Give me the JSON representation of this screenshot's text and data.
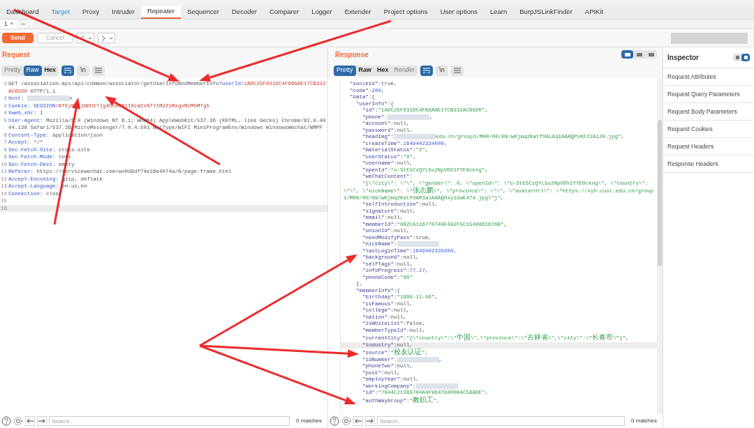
{
  "tabs": [
    {
      "label": "Dashboard",
      "selected": false,
      "highlighted": false
    },
    {
      "label": "Target",
      "selected": false,
      "highlighted": true
    },
    {
      "label": "Proxy",
      "selected": false,
      "highlighted": false
    },
    {
      "label": "Intruder",
      "selected": false,
      "highlighted": false
    },
    {
      "label": "Repeater",
      "selected": true,
      "highlighted": false
    },
    {
      "label": "Sequencer",
      "selected": false,
      "highlighted": false
    },
    {
      "label": "Decoder",
      "selected": false,
      "highlighted": false
    },
    {
      "label": "Comparer",
      "selected": false,
      "highlighted": false
    },
    {
      "label": "Logger",
      "selected": false,
      "highlighted": false
    },
    {
      "label": "Extender",
      "selected": false,
      "highlighted": false
    },
    {
      "label": "Project options",
      "selected": false,
      "highlighted": false
    },
    {
      "label": "User options",
      "selected": false,
      "highlighted": false
    },
    {
      "label": "Learn",
      "selected": false,
      "highlighted": false
    },
    {
      "label": "BurpJSLinkFinder",
      "selected": false,
      "highlighted": false
    },
    {
      "label": "APIKit",
      "selected": false,
      "highlighted": false
    }
  ],
  "subtabs": [
    {
      "label": "1",
      "close": "×",
      "selected": true
    },
    {
      "label": "–",
      "selected": false
    }
  ],
  "toolbar": {
    "send": "Send",
    "cancel": "Cancel",
    "cancel_disabled": true
  },
  "request": {
    "title": "Request",
    "view_tabs": [
      {
        "label": "Pretty",
        "selected": false,
        "disabled": true
      },
      {
        "label": "Raw",
        "selected": true,
        "disabled": false
      },
      {
        "label": "Hex",
        "selected": false,
        "disabled": false
      }
    ],
    "newline_button": "\\n",
    "lines": [
      {
        "n": "1",
        "highlighted": false,
        "parts": [
          {
            "kind": "text",
            "text": "GET /association-api/api/common/associator/getUserInfoAndMemberInfo?"
          },
          {
            "kind": "name",
            "text": "userId"
          },
          {
            "kind": "text",
            "text": "="
          },
          {
            "kind": "value",
            "text": "1ADC25F031DC4F66AAE17CB332AC65D0"
          },
          {
            "kind": "text",
            "text": " HTTP/1.1"
          }
        ]
      },
      {
        "n": "2",
        "highlighted": false,
        "parts": [
          {
            "kind": "name",
            "text": "Host"
          },
          {
            "kind": "text",
            "text": ": "
          },
          {
            "kind": "redacted"
          },
          {
            "kind": "text",
            "text": "n"
          }
        ]
      },
      {
        "n": "3",
        "highlighted": false,
        "parts": [
          {
            "kind": "name",
            "text": "Cookie"
          },
          {
            "kind": "text",
            "text": ": "
          },
          {
            "kind": "name",
            "text": "SESSION"
          },
          {
            "kind": "value",
            "text": "=NTEyNGI1NDUtYjg4OC00NjI0LWIxNTYtM2ZiMzgxMzM5MTg5"
          }
        ]
      },
      {
        "n": "4",
        "highlighted": false,
        "parts": [
          {
            "kind": "name",
            "text": "Xweb_xhr"
          },
          {
            "kind": "text",
            "text": ": 1"
          }
        ]
      },
      {
        "n": "5",
        "highlighted": false,
        "parts": [
          {
            "kind": "name",
            "text": "User-Agent"
          },
          {
            "kind": "text",
            "text": ": Mozilla/5.0 (Windows NT 6.1; WOW64) AppleWebKit/537.36 (KHTML, like Gecko) Chrome/81.0.4044.138 Safari/537.36 MicroMessenger/7.0.4.501 NetType/WIFI MiniProgramEnv/Windows WindowsWechat/WMPF"
          }
        ]
      },
      {
        "n": "6",
        "highlighted": false,
        "parts": [
          {
            "kind": "name",
            "text": "Content-Type"
          },
          {
            "kind": "text",
            "text": ": application/json"
          }
        ]
      },
      {
        "n": "7",
        "highlighted": false,
        "parts": [
          {
            "kind": "name",
            "text": "Accept"
          },
          {
            "kind": "text",
            "text": ": */*"
          }
        ]
      },
      {
        "n": "8",
        "highlighted": false,
        "parts": [
          {
            "kind": "name",
            "text": "Sec-Fetch-Site"
          },
          {
            "kind": "text",
            "text": ": cross-site"
          }
        ]
      },
      {
        "n": "9",
        "highlighted": false,
        "parts": [
          {
            "kind": "name",
            "text": "Sec-Fetch-Mode"
          },
          {
            "kind": "text",
            "text": ": cors"
          }
        ]
      },
      {
        "n": "10",
        "highlighted": false,
        "parts": [
          {
            "kind": "name",
            "text": "Sec-Fetch-Dest"
          },
          {
            "kind": "text",
            "text": ": empty"
          }
        ]
      },
      {
        "n": "11",
        "highlighted": false,
        "parts": [
          {
            "kind": "name",
            "text": "Referer"
          },
          {
            "kind": "text",
            "text": ": https://servicewechat.com/wx0d9df74e16e4074a/6/page-frame.html"
          }
        ]
      },
      {
        "n": "12",
        "highlighted": false,
        "parts": [
          {
            "kind": "name",
            "text": "Accept-Encoding"
          },
          {
            "kind": "text",
            "text": ": gzip, deflate"
          }
        ]
      },
      {
        "n": "13",
        "highlighted": false,
        "parts": [
          {
            "kind": "name",
            "text": "Accept-Language"
          },
          {
            "kind": "text",
            "text": ": en-us,en"
          }
        ]
      },
      {
        "n": "14",
        "highlighted": false,
        "parts": [
          {
            "kind": "name",
            "text": "Connection"
          },
          {
            "kind": "text",
            "text": ": close"
          }
        ]
      },
      {
        "n": "15",
        "highlighted": false
      },
      {
        "n": "16",
        "highlighted": true
      }
    ],
    "search": {
      "placeholder": "Search...",
      "matches": "0 matches"
    }
  },
  "response": {
    "title": "Response",
    "view_tabs": [
      {
        "label": "Pretty",
        "selected": true,
        "disabled": false
      },
      {
        "label": "Raw",
        "selected": false,
        "disabled": false
      },
      {
        "label": "Hex",
        "selected": false,
        "disabled": false
      },
      {
        "label": "Render",
        "selected": false,
        "disabled": true
      }
    ],
    "newline_button": "\\n",
    "layout_buttons": [
      {
        "selected": true
      },
      {
        "selected": false
      },
      {
        "selected": false
      }
    ],
    "lines": [
      {
        "highlighted": false,
        "parts": [
          {
            "kind": "key",
            "text": "  \"success\""
          },
          {
            "kind": "punc",
            "text": ":"
          },
          {
            "kind": "lit",
            "text": "true"
          },
          {
            "kind": "punc",
            "text": ","
          }
        ]
      },
      {
        "highlighted": false,
        "parts": [
          {
            "kind": "key",
            "text": "  \"code\""
          },
          {
            "kind": "punc",
            "text": ":"
          },
          {
            "kind": "num",
            "text": "200"
          },
          {
            "kind": "punc",
            "text": ","
          }
        ]
      },
      {
        "highlighted": false,
        "parts": [
          {
            "kind": "key",
            "text": "  \"data\""
          },
          {
            "kind": "punc",
            "text": ":{"
          }
        ]
      },
      {
        "highlighted": false,
        "parts": [
          {
            "kind": "key",
            "text": "    \"userInfo\""
          },
          {
            "kind": "punc",
            "text": ":{"
          }
        ]
      },
      {
        "highlighted": false,
        "parts": [
          {
            "kind": "key",
            "text": "      \"id\""
          },
          {
            "kind": "punc",
            "text": ":"
          },
          {
            "kind": "str",
            "text": "\"1ADC25F031DC4F66AAE17CB332AC65D0\""
          },
          {
            "kind": "punc",
            "text": ","
          }
        ]
      },
      {
        "highlighted": false,
        "parts": [
          {
            "kind": "key",
            "text": "      \"phone\""
          },
          {
            "kind": "punc",
            "text": ":"
          },
          {
            "kind": "redacted"
          },
          {
            "kind": "punc",
            "text": ","
          }
        ]
      },
      {
        "highlighted": false,
        "parts": [
          {
            "kind": "key",
            "text": "      \"account\""
          },
          {
            "kind": "punc",
            "text": ":"
          },
          {
            "kind": "lit",
            "text": "null"
          },
          {
            "kind": "punc",
            "text": ","
          }
        ]
      },
      {
        "highlighted": false,
        "parts": [
          {
            "kind": "key",
            "text": "      \"password\""
          },
          {
            "kind": "punc",
            "text": ":"
          },
          {
            "kind": "lit",
            "text": "null"
          },
          {
            "kind": "punc",
            "text": ","
          }
        ]
      },
      {
        "highlighted": false,
        "parts": [
          {
            "kind": "key",
            "text": "      \"headImg\""
          },
          {
            "kind": "punc",
            "text": ":"
          },
          {
            "kind": "redacted"
          },
          {
            "kind": "str",
            "text": "edu.cn/group1/M00/00/09/wKjmq2KatfOAL8qIAAAQPvKFZ2A120.jpg\""
          },
          {
            "kind": "punc",
            "text": ","
          }
        ]
      },
      {
        "highlighted": false,
        "parts": [
          {
            "kind": "key",
            "text": "      \"createTime\""
          },
          {
            "kind": "punc",
            "text": ":"
          },
          {
            "kind": "num",
            "text": "1649402334000"
          },
          {
            "kind": "punc",
            "text": ","
          }
        ]
      },
      {
        "highlighted": false,
        "parts": [
          {
            "kind": "key",
            "text": "      \"materialStatus\""
          },
          {
            "kind": "punc",
            "text": ":"
          },
          {
            "kind": "str",
            "text": "\"2\""
          },
          {
            "kind": "punc",
            "text": ","
          }
        ]
      },
      {
        "highlighted": false,
        "parts": [
          {
            "kind": "key",
            "text": "      \"userStatus\""
          },
          {
            "kind": "punc",
            "text": ":"
          },
          {
            "kind": "str",
            "text": "\"0\""
          },
          {
            "kind": "punc",
            "text": ","
          }
        ]
      },
      {
        "highlighted": false,
        "parts": [
          {
            "kind": "key",
            "text": "      \"username\""
          },
          {
            "kind": "punc",
            "text": ":"
          },
          {
            "kind": "lit",
            "text": "null"
          },
          {
            "kind": "punc",
            "text": ","
          }
        ]
      },
      {
        "highlighted": false,
        "parts": [
          {
            "kind": "key",
            "text": "      \"openId\""
          },
          {
            "kind": "punc",
            "text": ":"
          },
          {
            "kind": "str",
            "text": "\"o-StE5CzQYL5u2NpVDV1fYE0ckng\""
          },
          {
            "kind": "punc",
            "text": ","
          }
        ]
      },
      {
        "highlighted": false,
        "parts": [
          {
            "kind": "key",
            "text": "      \"weChatContent\""
          },
          {
            "kind": "punc",
            "text": ":"
          }
        ]
      },
      {
        "highlighted": false,
        "parts": [
          {
            "kind": "str",
            "text": "      \"{\\\"city\\\": \\\"\\\", \\\"gender\\\": 0, \\\"openId\\\": \\\"o-StE5CzQYL5u2NpVDV1fYE0ckng\\\", \\\"country\\\": \\\"\\\", \\\"nickName\\\": \\\"张志鹏\\\", \\\"province\\\": \\\"\\\", \\\"avatarUrl\\\": \\\"https://xyh.cust.edu.cn/group1/M00/00/09/wKjmq2KatfOAR3aJAAAQOxyi5wE474.jpg\\\"}\""
          },
          {
            "kind": "punc",
            "text": ","
          }
        ]
      },
      {
        "highlighted": false,
        "parts": [
          {
            "kind": "key",
            "text": "      \"selfIntroduction\""
          },
          {
            "kind": "punc",
            "text": ":"
          },
          {
            "kind": "lit",
            "text": "null"
          },
          {
            "kind": "punc",
            "text": ","
          }
        ]
      },
      {
        "highlighted": false,
        "parts": [
          {
            "kind": "key",
            "text": "      \"signature\""
          },
          {
            "kind": "punc",
            "text": ":"
          },
          {
            "kind": "lit",
            "text": "null"
          },
          {
            "kind": "punc",
            "text": ","
          }
        ]
      },
      {
        "highlighted": false,
        "parts": [
          {
            "kind": "key",
            "text": "      \"email\""
          },
          {
            "kind": "punc",
            "text": ":"
          },
          {
            "kind": "lit",
            "text": "null"
          },
          {
            "kind": "punc",
            "text": ","
          }
        ]
      },
      {
        "highlighted": false,
        "parts": [
          {
            "kind": "key",
            "text": "      \"memberId\""
          },
          {
            "kind": "punc",
            "text": ":"
          },
          {
            "kind": "str",
            "text": "\"082CA116770749E492F5C15408D1676B\""
          },
          {
            "kind": "punc",
            "text": ","
          }
        ]
      },
      {
        "highlighted": false,
        "parts": [
          {
            "kind": "key",
            "text": "      \"unionId\""
          },
          {
            "kind": "punc",
            "text": ":"
          },
          {
            "kind": "lit",
            "text": "null"
          },
          {
            "kind": "punc",
            "text": ","
          }
        ]
      },
      {
        "highlighted": false,
        "parts": [
          {
            "kind": "key",
            "text": "      \"needModifyPass\""
          },
          {
            "kind": "punc",
            "text": ":"
          },
          {
            "kind": "lit",
            "text": "true"
          },
          {
            "kind": "punc",
            "text": ","
          }
        ]
      },
      {
        "highlighted": false,
        "parts": [
          {
            "kind": "key",
            "text": "      \"nickName\""
          },
          {
            "kind": "punc",
            "text": ":"
          },
          {
            "kind": "redacted"
          }
        ]
      },
      {
        "highlighted": false,
        "parts": [
          {
            "kind": "key",
            "text": "      \"lastLoginTime\""
          },
          {
            "kind": "punc",
            "text": ":"
          },
          {
            "kind": "num",
            "text": "1649402335000"
          },
          {
            "kind": "punc",
            "text": ","
          }
        ]
      },
      {
        "highlighted": false,
        "parts": [
          {
            "kind": "key",
            "text": "      \"background\""
          },
          {
            "kind": "punc",
            "text": ":"
          },
          {
            "kind": "lit",
            "text": "null"
          },
          {
            "kind": "punc",
            "text": ","
          }
        ]
      },
      {
        "highlighted": false,
        "parts": [
          {
            "kind": "key",
            "text": "      \"selfTags\""
          },
          {
            "kind": "punc",
            "text": ":"
          },
          {
            "kind": "lit",
            "text": "null"
          },
          {
            "kind": "punc",
            "text": ","
          }
        ]
      },
      {
        "highlighted": false,
        "parts": [
          {
            "kind": "key",
            "text": "      \"infoProgress\""
          },
          {
            "kind": "punc",
            "text": ":"
          },
          {
            "kind": "num",
            "text": "77.27"
          },
          {
            "kind": "punc",
            "text": ","
          }
        ]
      },
      {
        "highlighted": false,
        "parts": [
          {
            "kind": "key",
            "text": "      \"phoneCode\""
          },
          {
            "kind": "punc",
            "text": ":"
          },
          {
            "kind": "str",
            "text": "\"86\""
          }
        ]
      },
      {
        "highlighted": false,
        "parts": [
          {
            "kind": "punc",
            "text": "    },"
          }
        ]
      },
      {
        "highlighted": false,
        "parts": [
          {
            "kind": "key",
            "text": "    \"memberInfo\""
          },
          {
            "kind": "punc",
            "text": ":{"
          }
        ]
      },
      {
        "highlighted": false,
        "parts": [
          {
            "kind": "key",
            "text": "      \"birthday\""
          },
          {
            "kind": "punc",
            "text": ":"
          },
          {
            "kind": "str",
            "text": "\"1980-11-06\""
          },
          {
            "kind": "punc",
            "text": ","
          }
        ]
      },
      {
        "highlighted": false,
        "parts": [
          {
            "kind": "key",
            "text": "      \"isFamous\""
          },
          {
            "kind": "punc",
            "text": ":"
          },
          {
            "kind": "lit",
            "text": "null"
          },
          {
            "kind": "punc",
            "text": ","
          }
        ]
      },
      {
        "highlighted": false,
        "parts": [
          {
            "kind": "key",
            "text": "      \"college\""
          },
          {
            "kind": "punc",
            "text": ":"
          },
          {
            "kind": "lit",
            "text": "null"
          },
          {
            "kind": "punc",
            "text": ","
          }
        ]
      },
      {
        "highlighted": false,
        "parts": [
          {
            "kind": "key",
            "text": "      \"nation\""
          },
          {
            "kind": "punc",
            "text": ":"
          },
          {
            "kind": "lit",
            "text": "null"
          },
          {
            "kind": "punc",
            "text": ","
          }
        ]
      },
      {
        "highlighted": false,
        "parts": [
          {
            "kind": "key",
            "text": "      \"isWhiteList\""
          },
          {
            "kind": "punc",
            "text": ":"
          },
          {
            "kind": "lit",
            "text": "false"
          },
          {
            "kind": "punc",
            "text": ","
          }
        ]
      },
      {
        "highlighted": false,
        "parts": [
          {
            "kind": "key",
            "text": "      \"memberTypeId\""
          },
          {
            "kind": "punc",
            "text": ":"
          },
          {
            "kind": "lit",
            "text": "null"
          },
          {
            "kind": "punc",
            "text": ","
          }
        ]
      },
      {
        "highlighted": false,
        "parts": [
          {
            "kind": "key",
            "text": "      \"currentCity\""
          },
          {
            "kind": "punc",
            "text": ":"
          },
          {
            "kind": "str",
            "text": "\"{\\\"country\\\":\\\"中国\\\",\\\"province\\\":\\\"吉林省\\\",\\\"city\\\":\\\"长春市\\\"}\""
          },
          {
            "kind": "punc",
            "text": ","
          }
        ]
      },
      {
        "highlighted": true,
        "parts": [
          {
            "kind": "key",
            "text": "      \"industry\""
          },
          {
            "kind": "punc",
            "text": ":"
          },
          {
            "kind": "lit",
            "text": "null"
          },
          {
            "kind": "punc",
            "text": ","
          }
        ]
      },
      {
        "highlighted": false,
        "parts": [
          {
            "kind": "key",
            "text": "      \"source\""
          },
          {
            "kind": "punc",
            "text": ":"
          },
          {
            "kind": "str",
            "text": "\"校友认证\""
          },
          {
            "kind": "punc",
            "text": ","
          }
        ]
      },
      {
        "highlighted": false,
        "parts": [
          {
            "kind": "key",
            "text": "      \"idNumber\""
          },
          {
            "kind": "punc",
            "text": ":"
          },
          {
            "kind": "redacted"
          },
          {
            "kind": "punc",
            "text": ","
          }
        ]
      },
      {
        "highlighted": false,
        "parts": [
          {
            "kind": "key",
            "text": "      \"phoneTwo\""
          },
          {
            "kind": "punc",
            "text": ":"
          },
          {
            "kind": "lit",
            "text": "null"
          },
          {
            "kind": "punc",
            "text": ","
          }
        ]
      },
      {
        "highlighted": false,
        "parts": [
          {
            "kind": "key",
            "text": "      \"post\""
          },
          {
            "kind": "punc",
            "text": ":"
          },
          {
            "kind": "lit",
            "text": "null"
          },
          {
            "kind": "punc",
            "text": ","
          }
        ]
      },
      {
        "highlighted": false,
        "parts": [
          {
            "kind": "key",
            "text": "      \"employYear\""
          },
          {
            "kind": "punc",
            "text": ":"
          },
          {
            "kind": "lit",
            "text": "null"
          },
          {
            "kind": "punc",
            "text": ","
          }
        ]
      },
      {
        "highlighted": false,
        "parts": [
          {
            "kind": "key",
            "text": "      \"workingCompany\""
          },
          {
            "kind": "punc",
            "text": ":"
          },
          {
            "kind": "redacted"
          }
        ]
      },
      {
        "highlighted": false,
        "parts": [
          {
            "kind": "key",
            "text": "      \"id\""
          },
          {
            "kind": "punc",
            "text": ":"
          },
          {
            "kind": "str",
            "text": "\"7844C21389704A4F964784D084C58ADE\""
          },
          {
            "kind": "punc",
            "text": ","
          }
        ]
      },
      {
        "highlighted": false,
        "parts": [
          {
            "kind": "key",
            "text": "      \"authWayGroup\""
          },
          {
            "kind": "punc",
            "text": ":"
          },
          {
            "kind": "str",
            "text": "\"教职工\""
          },
          {
            "kind": "punc",
            "text": ","
          }
        ]
      }
    ],
    "search": {
      "placeholder": "Search...",
      "matches": "0 matches"
    }
  },
  "inspector": {
    "title": "Inspector",
    "layout_buttons": [
      {
        "selected": false
      },
      {
        "selected": true
      }
    ],
    "sections": [
      "Request Attributes",
      "Request Query Parameters",
      "Request Body Parameters",
      "Request Cookies",
      "Request Headers",
      "Response Headers"
    ]
  }
}
